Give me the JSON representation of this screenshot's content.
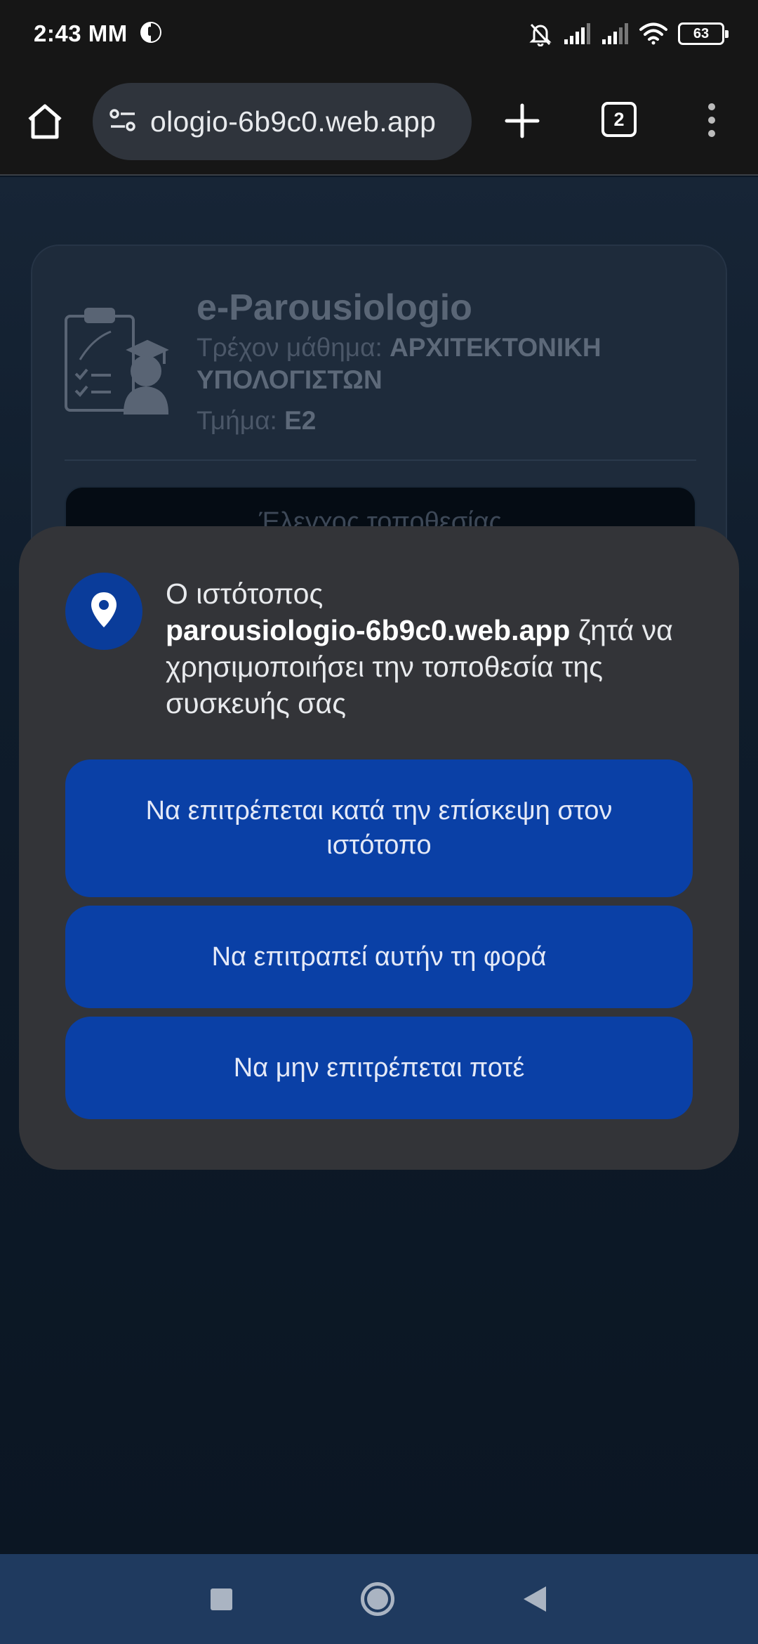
{
  "status_bar": {
    "time": "2:43 MM",
    "battery": "63"
  },
  "browser": {
    "url": "ologio-6b9c0.web.app",
    "tab_count": "2"
  },
  "page": {
    "app_title": "e-Parousiologio",
    "course_label": "Τρέχον μάθημα:",
    "course_name": "ΑΡΧΙΤΕΚΤΟΝΙΚΗ ΥΠΟΛΟΓΙΣΤΩΝ",
    "section_label": "Τμήμα:",
    "section_value": "Ε2",
    "location_button": "Έλεγχος τοποθεσίας"
  },
  "dialog": {
    "message_prefix": "Ο ιστότοπος",
    "site": "parousiologio-6b9c0.web.app",
    "message_suffix": "ζητά να χρησιμοποιήσει την τοποθεσία της συσκευής σας",
    "buttons": [
      {
        "label": "Να επιτρέπεται κατά την επίσκεψη στον ιστότοπο"
      },
      {
        "label": "Να επιτραπεί αυτήν τη φορά"
      },
      {
        "label": "Να μην επιτρέπεται ποτέ"
      }
    ],
    "accent_color": "#0a40a6"
  }
}
